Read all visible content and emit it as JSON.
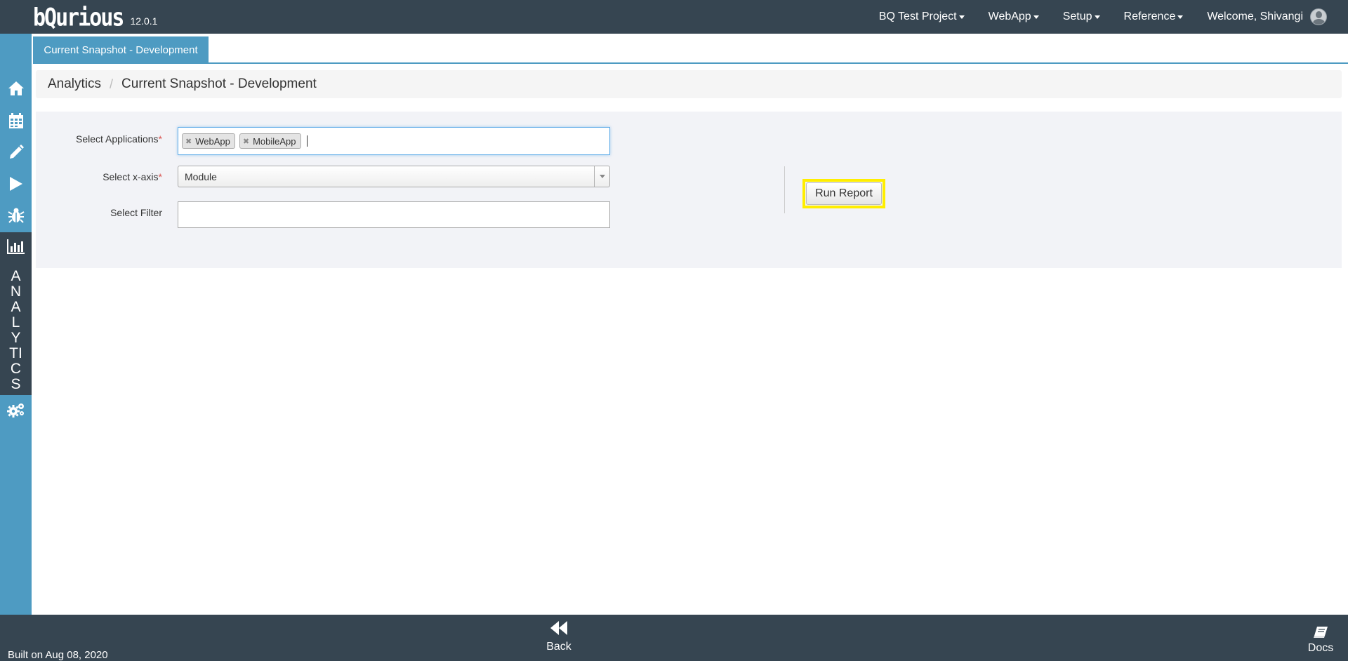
{
  "app": {
    "logo_text": "bQurious",
    "version": "12.0.1"
  },
  "topnav": {
    "project": "BQ Test Project",
    "app_menu": "WebApp",
    "setup": "Setup",
    "reference": "Reference",
    "welcome": "Welcome, Shivangi"
  },
  "sidebar": {
    "items": [
      {
        "icon": "home-icon"
      },
      {
        "icon": "calendar-icon"
      },
      {
        "icon": "pencil-icon"
      },
      {
        "icon": "play-icon"
      },
      {
        "icon": "bug-icon"
      },
      {
        "icon": "bar-chart-icon"
      },
      {
        "icon": "gears-icon"
      }
    ],
    "active_label_lines": [
      "A",
      "N",
      "A",
      "L",
      "Y",
      "TI",
      "C",
      "S"
    ]
  },
  "tab": {
    "label": "Current Snapshot - Development"
  },
  "breadcrumb": {
    "root": "Analytics",
    "current": "Current Snapshot - Development"
  },
  "form": {
    "applications_label": "Select Applications",
    "applications_tags": [
      "WebApp",
      "MobileApp"
    ],
    "xaxis_label": "Select x-axis",
    "xaxis_value": "Module",
    "filter_label": "Select Filter",
    "filter_value": "",
    "required_mark": "*",
    "run_button": "Run Report"
  },
  "footer": {
    "built": "Built on Aug 08, 2020",
    "back": "Back",
    "docs": "Docs"
  },
  "colors": {
    "navbar": "#364551",
    "sidebar": "#4e9bc2",
    "highlight": "#ffee00"
  }
}
